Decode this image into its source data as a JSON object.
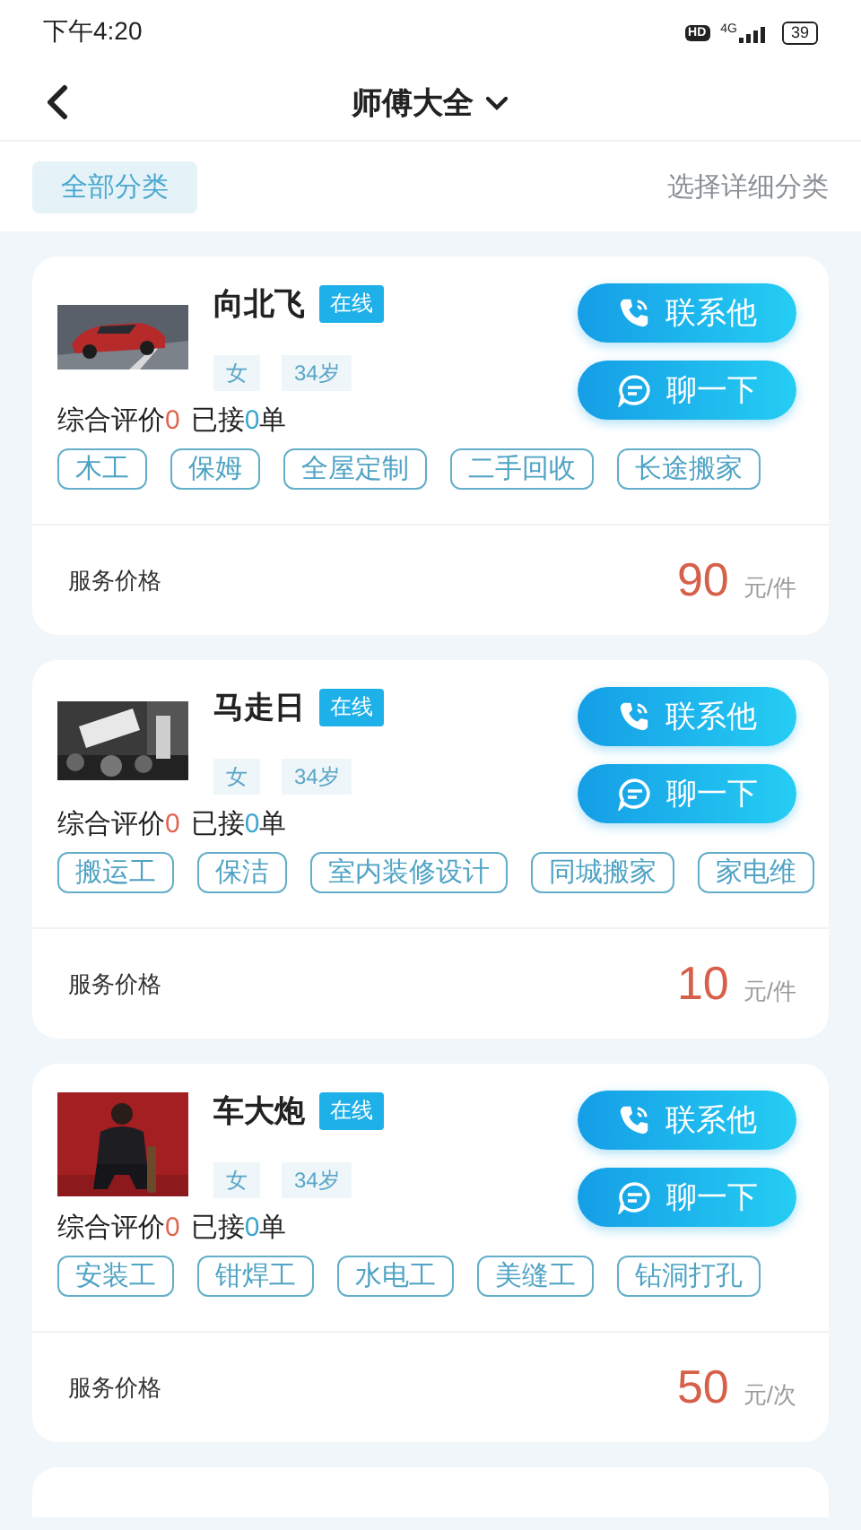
{
  "status_bar": {
    "time": "下午4:20",
    "hd": "HD",
    "network": "4G",
    "battery": "39"
  },
  "header": {
    "title": "师傅大全"
  },
  "filter": {
    "all_label": "全部分类",
    "detail_label": "选择详细分类"
  },
  "workers": [
    {
      "name": "向北飞",
      "status": "在线",
      "gender": "女",
      "age": "34岁",
      "rating_label": "综合评价",
      "rating": "0",
      "orders_label": "已接",
      "orders": "0",
      "orders_unit": "单",
      "contact": "联系他",
      "chat": "聊一下",
      "skills": [
        "木工",
        "保姆",
        "全屋定制",
        "二手回收",
        "长途搬家"
      ],
      "price_label": "服务价格",
      "price": "90",
      "unit": "元/件"
    },
    {
      "name": "马走日",
      "status": "在线",
      "gender": "女",
      "age": "34岁",
      "rating_label": "综合评价",
      "rating": "0",
      "orders_label": "已接",
      "orders": "0",
      "orders_unit": "单",
      "contact": "联系他",
      "chat": "聊一下",
      "skills": [
        "搬运工",
        "保洁",
        "室内装修设计",
        "同城搬家",
        "家电维"
      ],
      "price_label": "服务价格",
      "price": "10",
      "unit": "元/件"
    },
    {
      "name": "车大炮",
      "status": "在线",
      "gender": "女",
      "age": "34岁",
      "rating_label": "综合评价",
      "rating": "0",
      "orders_label": "已接",
      "orders": "0",
      "orders_unit": "单",
      "contact": "联系他",
      "chat": "聊一下",
      "skills": [
        "安装工",
        "钳焊工",
        "水电工",
        "美缝工",
        "钻洞打孔"
      ],
      "price_label": "服务价格",
      "price": "50",
      "unit": "元/次"
    }
  ]
}
